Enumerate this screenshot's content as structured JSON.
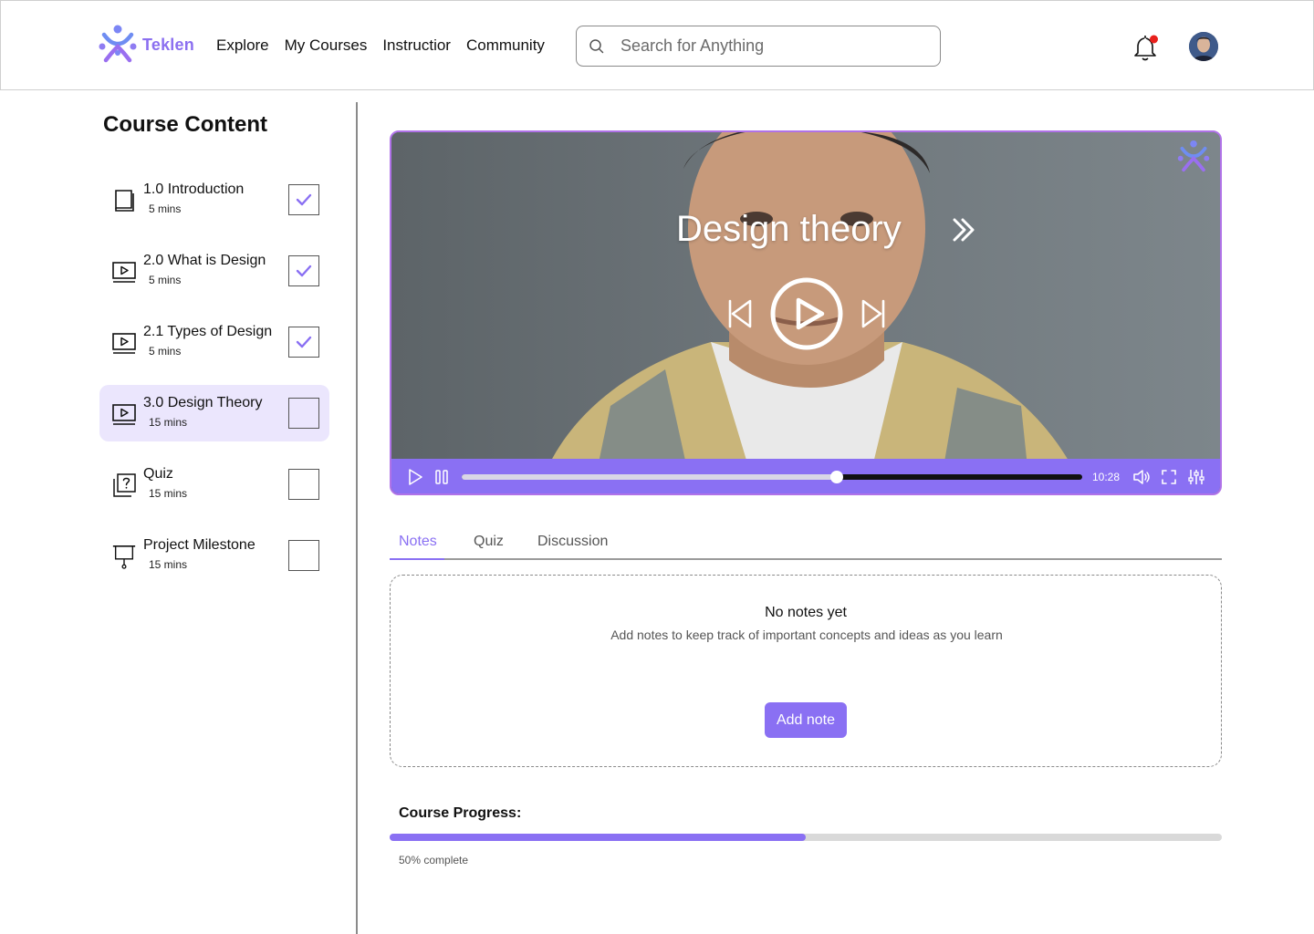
{
  "header": {
    "brand": "Teklen",
    "brand_color": "#8b6ff0",
    "nav": [
      "Explore",
      "My Courses",
      "Instructior",
      "Community"
    ],
    "search_placeholder": "Search for Anything",
    "notification_dot_color": "#e8201c"
  },
  "sidebar": {
    "title": "Course Content",
    "lessons": [
      {
        "title": "1.0 Introduction",
        "duration": "5 mins",
        "icon": "book-icon",
        "completed": true,
        "active": false
      },
      {
        "title": "2.0 What is Design",
        "duration": "5 mins",
        "icon": "video-lesson-icon",
        "completed": true,
        "active": false
      },
      {
        "title": "2.1 Types of Design",
        "duration": "5 mins",
        "icon": "video-lesson-icon",
        "completed": true,
        "active": false
      },
      {
        "title": "3.0 Design Theory",
        "duration": "15 mins",
        "icon": "video-lesson-icon",
        "completed": false,
        "active": true
      },
      {
        "title": "Quiz",
        "duration": "15 mins",
        "icon": "quiz-icon",
        "completed": false,
        "active": false
      },
      {
        "title": "Project Milestone",
        "duration": "15 mins",
        "icon": "presentation-board-icon",
        "completed": false,
        "active": false
      }
    ]
  },
  "video": {
    "title": "Design theory",
    "time": "10:28",
    "playback_progress": 0.605,
    "accent_color": "#8a70f3",
    "border_color": "#b072e8"
  },
  "tabs": [
    {
      "label": "Notes",
      "active": true
    },
    {
      "label": "Quiz",
      "active": false
    },
    {
      "label": "Discussion",
      "active": false
    }
  ],
  "notes": {
    "empty_title": "No notes yet",
    "empty_subtitle": "Add notes to keep track of important concepts and ideas as you learn",
    "add_button": "Add note"
  },
  "progress": {
    "label": "Course Progress:",
    "percent": 50,
    "text": "50% complete"
  }
}
